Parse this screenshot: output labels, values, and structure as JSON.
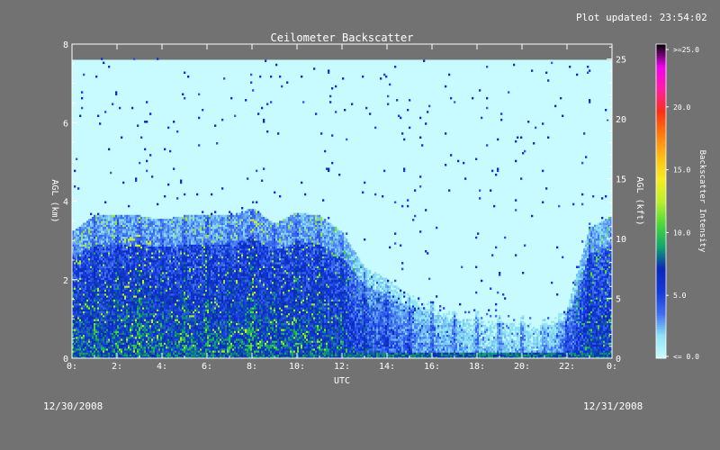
{
  "header": {
    "updated_text": "Plot updated: 23:54:02"
  },
  "footer": {
    "date_start": "12/30/2008",
    "date_end": "12/31/2008"
  },
  "colors": {
    "background": "#727272",
    "plot_background": "#c8fbff"
  },
  "chart_data": {
    "type": "heatmap",
    "title": "Ceilometer Backscatter",
    "xlabel": "UTC",
    "ylabel_left": "AGL (km)",
    "ylabel_right": "AGL (kft)",
    "xlim": [
      0,
      24
    ],
    "ylim_km": [
      0,
      8
    ],
    "ylim_kft": [
      0,
      26.25
    ],
    "x_ticks": [
      "0:",
      "2:",
      "4:",
      "6:",
      "8:",
      "10:",
      "12:",
      "14:",
      "16:",
      "18:",
      "20:",
      "22:",
      "0:"
    ],
    "y_ticks_km": [
      "0",
      "2",
      "4",
      "6",
      "8"
    ],
    "y_ticks_kft": [
      "0",
      "5",
      "10",
      "15",
      "20",
      "25"
    ],
    "data_top_km": 7.6,
    "colorbar": {
      "label": "Backscatter Intensity",
      "range": [
        0,
        25
      ],
      "tick_labels": [
        "<= 0.0",
        "5.0",
        "10.0",
        "15.0",
        "20.0",
        ">=25.0"
      ],
      "stops": [
        "#c8fbff",
        "#8ee4f5",
        "#3f6ef0",
        "#1238d8",
        "#0a27b8",
        "#11a86a",
        "#4ed83a",
        "#bdef2c",
        "#f7ee20",
        "#ffbc14",
        "#ff7a0c",
        "#f93016",
        "#ff1fa2",
        "#ee00ee",
        "#000000"
      ]
    },
    "profile_time_utc": [
      0,
      1,
      2,
      3,
      4,
      5,
      6,
      7,
      8,
      9,
      10,
      11,
      12,
      13,
      14,
      15,
      16,
      17,
      18,
      19,
      20,
      21,
      22,
      23,
      24
    ],
    "scatter_top_km": [
      3.2,
      3.6,
      3.6,
      3.6,
      3.5,
      3.6,
      3.6,
      3.6,
      3.8,
      3.4,
      3.7,
      3.6,
      3.2,
      2.3,
      2.0,
      1.6,
      1.4,
      1.2,
      1.2,
      1.1,
      1.1,
      1.0,
      1.2,
      3.3,
      3.6
    ],
    "peak_intensity": [
      10,
      10,
      10,
      11,
      10,
      10,
      10,
      10,
      11,
      10,
      10,
      10,
      9,
      7,
      6,
      5,
      4,
      4,
      3,
      3,
      3,
      3,
      6,
      9,
      9
    ]
  }
}
